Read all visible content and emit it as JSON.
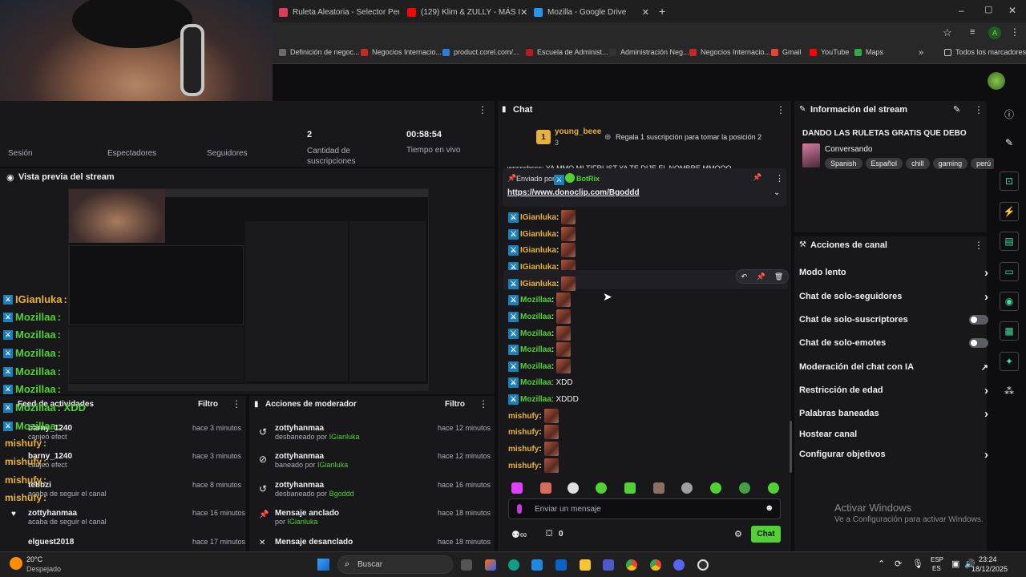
{
  "browser": {
    "tabs": [
      {
        "label": "Ruleta Aleatoria - Selector Perso",
        "color": "#e23b5a"
      },
      {
        "label": "(129) Klim & ZULLY - MÁS I",
        "color": "#ff0000"
      },
      {
        "label": "Mozilla - Google Drive",
        "color": "#2196f3"
      }
    ],
    "window_controls": {
      "min": "–",
      "max": "▢",
      "close": "✕"
    },
    "bookmarks": [
      {
        "label": "Definición de negoc...",
        "color": "#6b6b6b"
      },
      {
        "label": "Negocios Internacio...",
        "color": "#c62828"
      },
      {
        "label": "product.corel.com/...",
        "color": "#2e7dd7"
      },
      {
        "label": "Escuela de Administ...",
        "color": "#b71c1c"
      },
      {
        "label": "Administración Neg...",
        "color": "#333333"
      },
      {
        "label": "Negocios Internacio...",
        "color": "#c62828"
      },
      {
        "label": "Gmail",
        "color": "#ea4335"
      },
      {
        "label": "YouTube",
        "color": "#ff0000"
      },
      {
        "label": "Maps",
        "color": "#34a853"
      }
    ],
    "bookmarks_folder": "Todos los marcadores",
    "profile_letter": "A"
  },
  "stats": {
    "subs_value": "2",
    "subs_label": "Cantidad de suscripciones",
    "live_value": "00:58:54",
    "live_label": "Tiempo en vivo",
    "session_label": "Sesión",
    "viewers_label": "Espectadores",
    "followers_label": "Seguidores"
  },
  "preview": {
    "title": "Vista previa del stream"
  },
  "overlay_chat": [
    {
      "user": "IGianluka",
      "text": ":",
      "color": "#e8b13c"
    },
    {
      "user": "Mozillaa",
      "text": ":",
      "color": "#52d135"
    },
    {
      "user": "Mozillaa",
      "text": ":",
      "color": "#52d135"
    },
    {
      "user": "Mozillaa",
      "text": ":",
      "color": "#52d135"
    },
    {
      "user": "Mozillaa",
      "text": ":",
      "color": "#52d135"
    },
    {
      "user": "Mozillaa",
      "text": ":",
      "color": "#52d135"
    },
    {
      "user": "Mozillaa",
      "text": ": XDD",
      "color": "#52d135"
    },
    {
      "user": "Mozillaa",
      "text": ":",
      "color": "#52d135"
    },
    {
      "user": "mishufy",
      "text": ":",
      "color": "#e8b13c"
    },
    {
      "user": "mishufy",
      "text": ":",
      "color": "#e8b13c"
    },
    {
      "user": "mishufy",
      "text": ":",
      "color": "#e8b13c"
    },
    {
      "user": "mishufy",
      "text": ":",
      "color": "#e8b13c"
    }
  ],
  "activity": {
    "title": "Feed de actividades",
    "filter": "Filtro",
    "items": [
      {
        "name": "barny_1240",
        "sub": "canjeó efect",
        "time": "hace 3 minutos"
      },
      {
        "name": "barny_1240",
        "sub": "canjeó efect",
        "time": "hace 3 minutos"
      },
      {
        "name": "tebbzi",
        "sub": "acaba de seguir el canal",
        "time": "hace 8 minutos"
      },
      {
        "name": "zottyhanmaa",
        "sub": "acaba de seguir el canal",
        "time": "hace 16 minutos"
      },
      {
        "name": "elguest2018",
        "sub": "",
        "time": "hace 17 minutos"
      }
    ]
  },
  "mod_actions": {
    "title": "Acciones de moderador",
    "filter": "Filtro",
    "items": [
      {
        "name": "zottyhanmaa",
        "sub_pre": "desbaneado por ",
        "by": "IGianluka",
        "time": "hace 12 minutos",
        "icon": "↺"
      },
      {
        "name": "zottyhanmaa",
        "sub_pre": "baneado por ",
        "by": "IGianluka",
        "time": "hace 12 minutos",
        "icon": "⊘"
      },
      {
        "name": "zottyhanmaa",
        "sub_pre": "desbaneado por ",
        "by": "Bgoddd",
        "time": "hace 16 minutos",
        "icon": "↺"
      },
      {
        "name": "Mensaje anclado",
        "sub_pre": "por ",
        "by": "IGianluka",
        "time": "hace 18 minutos",
        "icon": "📌"
      },
      {
        "name": "Mensaje desanclado",
        "sub_pre": "",
        "by": "",
        "time": "hace 18 minutos",
        "icon": "✕"
      }
    ]
  },
  "chat": {
    "title": "Chat",
    "top_gifter": {
      "rank": "1",
      "name": "young_beee",
      "count": "3",
      "prompt": "Regala 1 suscripción para tomar la posición 2"
    },
    "scrolling_text": "wsssshsss: YA MMQ MI TIFRLIST YA TE DIJE EL NOMBRE MMQQQ",
    "pinned": {
      "prefix": "Enviado por",
      "by": "BotRix",
      "link": "https://www.donoclip.com/Bgoddd"
    },
    "messages": [
      {
        "user": "IGianluka",
        "text": ":",
        "color": "#e8b13c",
        "emote": true
      },
      {
        "user": "IGianluka",
        "text": ":",
        "color": "#e8b13c",
        "emote": true
      },
      {
        "user": "IGianluka",
        "text": ":",
        "color": "#e8b13c",
        "emote": true
      },
      {
        "user": "IGianluka",
        "text": ":",
        "color": "#e8b13c",
        "emote": true
      },
      {
        "user": "IGianluka",
        "text": ":",
        "color": "#e8b13c",
        "emote": true
      },
      {
        "user": "Mozillaa",
        "text": ":",
        "color": "#52d135",
        "emote": true
      },
      {
        "user": "Mozillaa",
        "text": ":",
        "color": "#52d135",
        "emote": true
      },
      {
        "user": "Mozillaa",
        "text": ":",
        "color": "#52d135",
        "emote": true
      },
      {
        "user": "Mozillaa",
        "text": ":",
        "color": "#52d135",
        "emote": true
      },
      {
        "user": "Mozillaa",
        "text": ":",
        "color": "#52d135",
        "emote": true
      },
      {
        "user": "Mozillaa",
        "text": ": XDD",
        "color": "#52d135",
        "emote": false
      },
      {
        "user": "Mozillaa",
        "text": ": XDDD",
        "color": "#52d135",
        "emote": false
      },
      {
        "user": "mishufy",
        "text": ":",
        "color": "#e8b13c",
        "emote": true
      },
      {
        "user": "mishufy",
        "text": ":",
        "color": "#e8b13c",
        "emote": true
      },
      {
        "user": "mishufy",
        "text": ":",
        "color": "#e8b13c",
        "emote": true
      },
      {
        "user": "mishufy",
        "text": ":",
        "color": "#e8b13c",
        "emote": true
      }
    ],
    "input_placeholder": "Enviar un mensaje",
    "points": "0",
    "send_label": "Chat"
  },
  "stream_info": {
    "title": "Información del stream",
    "stream_title": "DANDO LAS RULETAS GRATIS QUE DEBO",
    "category": "Conversando",
    "tags": [
      "Spanish",
      "Español",
      "chill",
      "gaming",
      "perú"
    ]
  },
  "channel_actions": {
    "title": "Acciones de canal",
    "items": [
      {
        "label": "Modo lento",
        "control": "chevron"
      },
      {
        "label": "Chat de solo-seguidores",
        "control": "chevron"
      },
      {
        "label": "Chat de solo-suscriptores",
        "control": "toggle"
      },
      {
        "label": "Chat de solo-emotes",
        "control": "toggle"
      },
      {
        "label": "Moderación del chat con IA",
        "control": "external"
      },
      {
        "label": "Restricción de edad",
        "control": "chevron"
      },
      {
        "label": "Palabras baneadas",
        "control": "chevron"
      },
      {
        "label": "Hostear canal",
        "control": "none"
      },
      {
        "label": "Configurar objetivos",
        "control": "chevron"
      }
    ]
  },
  "windows_watermark": {
    "line1": "Activar Windows",
    "line2": "Ve a Configuración para activar Windows."
  },
  "taskbar": {
    "temp": "20°C",
    "weather": "Despejado",
    "search_placeholder": "Buscar",
    "lang1": "ESP",
    "lang2": "ES",
    "time": "23:24",
    "date": "18/12/2025"
  }
}
